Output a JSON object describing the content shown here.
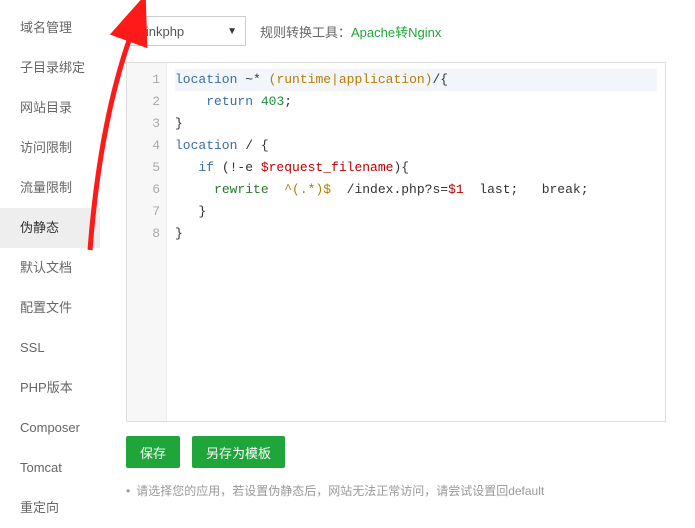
{
  "sidebar": {
    "items": [
      {
        "label": "域名管理"
      },
      {
        "label": "子目录绑定"
      },
      {
        "label": "网站目录"
      },
      {
        "label": "访问限制"
      },
      {
        "label": "流量限制"
      },
      {
        "label": "伪静态"
      },
      {
        "label": "默认文档"
      },
      {
        "label": "配置文件"
      },
      {
        "label": "SSL"
      },
      {
        "label": "PHP版本"
      },
      {
        "label": "Composer"
      },
      {
        "label": "Tomcat"
      },
      {
        "label": "重定向"
      }
    ],
    "active_index": 5
  },
  "top": {
    "select_value": "thinkphp",
    "convert_label": "规则转换工具：",
    "convert_link": "Apache转Nginx"
  },
  "code": {
    "lines": [
      {
        "n": 1,
        "segments": [
          {
            "t": "location",
            "c": "kw-dir"
          },
          {
            "t": " ~* ",
            "c": "punct"
          },
          {
            "t": "(runtime|application)",
            "c": "regex"
          },
          {
            "t": "/{",
            "c": "punct"
          }
        ],
        "hl": true
      },
      {
        "n": 2,
        "segments": [
          {
            "t": "    ",
            "c": ""
          },
          {
            "t": "return",
            "c": "kw-dir"
          },
          {
            "t": " ",
            "c": ""
          },
          {
            "t": "403",
            "c": "num"
          },
          {
            "t": ";",
            "c": "punct"
          }
        ]
      },
      {
        "n": 3,
        "segments": [
          {
            "t": "}",
            "c": "punct"
          }
        ]
      },
      {
        "n": 4,
        "segments": [
          {
            "t": "location",
            "c": "kw-dir"
          },
          {
            "t": " / {",
            "c": "punct"
          }
        ]
      },
      {
        "n": 5,
        "segments": [
          {
            "t": "   ",
            "c": ""
          },
          {
            "t": "if",
            "c": "kw-dir"
          },
          {
            "t": " (!-e ",
            "c": "punct"
          },
          {
            "t": "$request_filename",
            "c": "var"
          },
          {
            "t": "){",
            "c": "punct"
          }
        ]
      },
      {
        "n": 6,
        "segments": [
          {
            "t": "     ",
            "c": ""
          },
          {
            "t": "rewrite",
            "c": "rw"
          },
          {
            "t": "  ",
            "c": ""
          },
          {
            "t": "^(.*)$",
            "c": "regex"
          },
          {
            "t": "  /index.php?s=",
            "c": "punct"
          },
          {
            "t": "$1",
            "c": "var"
          },
          {
            "t": "  last;   break;",
            "c": "punct"
          }
        ]
      },
      {
        "n": 7,
        "segments": [
          {
            "t": "   }",
            "c": "punct"
          }
        ]
      },
      {
        "n": 8,
        "segments": [
          {
            "t": "}",
            "c": "punct"
          }
        ]
      }
    ]
  },
  "buttons": {
    "save": "保存",
    "save_as_template": "另存为模板"
  },
  "hint": {
    "text": "请选择您的应用，若设置伪静态后，网站无法正常访问，请尝试设置回default"
  }
}
